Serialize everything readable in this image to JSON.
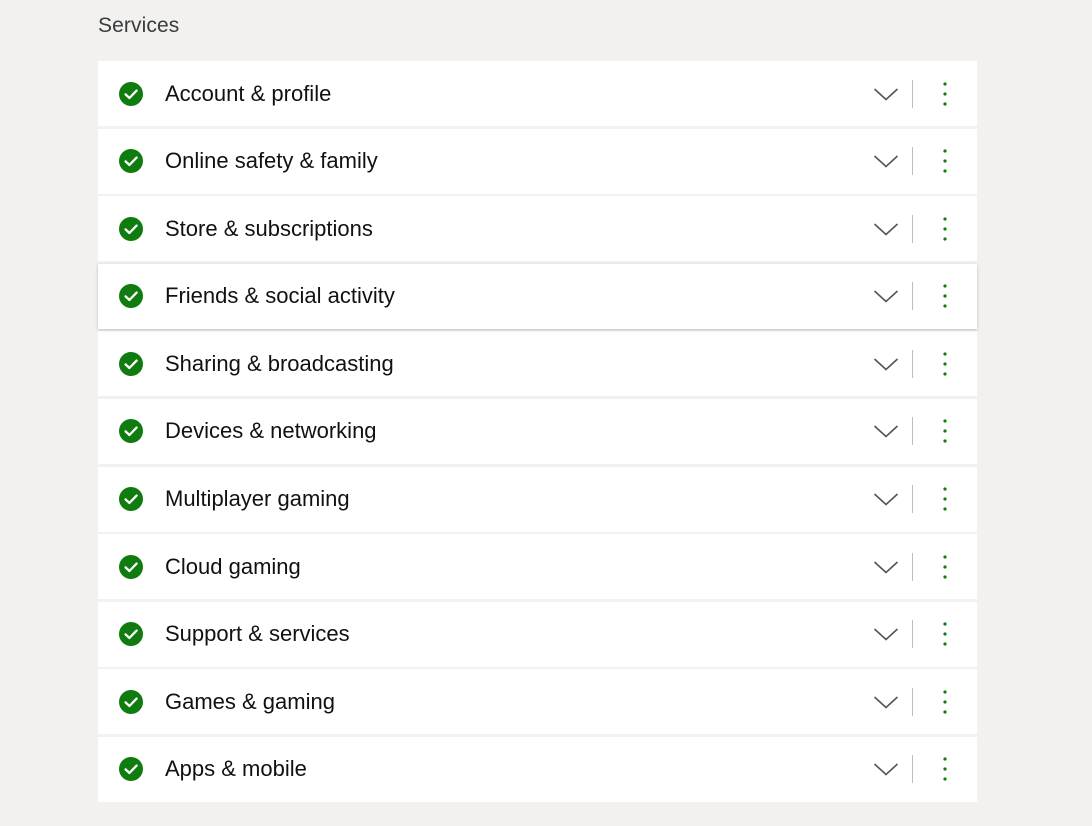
{
  "section": {
    "heading": "Services"
  },
  "colors": {
    "status_ok": "#107c10",
    "accent_dots": "#107c10",
    "page_background": "#f2f1f0",
    "row_background": "#ffffff"
  },
  "icons": {
    "status": "checkmark-circle-icon",
    "expand": "chevron-down-icon",
    "more": "more-vertical-icon"
  },
  "services": [
    {
      "label": "Account & profile",
      "status": "ok"
    },
    {
      "label": "Online safety & family",
      "status": "ok"
    },
    {
      "label": "Store & subscriptions",
      "status": "ok"
    },
    {
      "label": "Friends & social activity",
      "status": "ok"
    },
    {
      "label": "Sharing & broadcasting",
      "status": "ok"
    },
    {
      "label": "Devices & networking",
      "status": "ok"
    },
    {
      "label": "Multiplayer gaming",
      "status": "ok"
    },
    {
      "label": "Cloud gaming",
      "status": "ok"
    },
    {
      "label": "Support & services",
      "status": "ok"
    },
    {
      "label": "Games & gaming",
      "status": "ok"
    },
    {
      "label": "Apps & mobile",
      "status": "ok"
    }
  ]
}
